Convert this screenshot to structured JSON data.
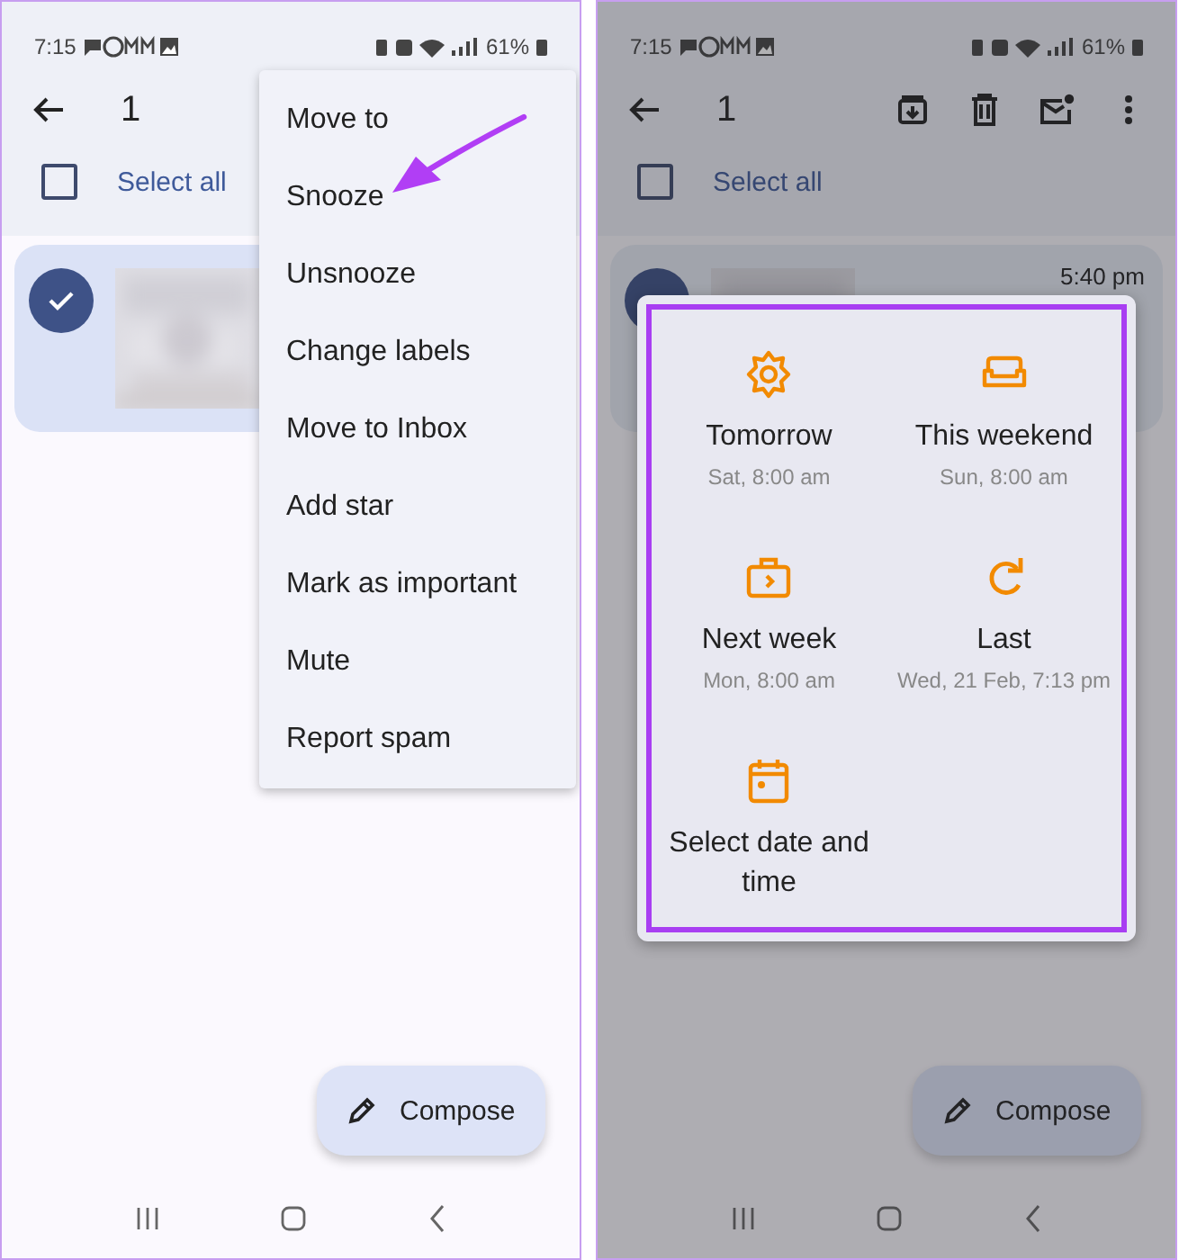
{
  "screens": [
    {
      "kind": "menu",
      "dimmed": false,
      "status_bar": {
        "time": "7:15",
        "battery": "61%"
      },
      "app_bar": {
        "count": "1"
      },
      "select_all": {
        "label": "Select all",
        "checked": false
      },
      "email": {
        "selected": true
      },
      "overflow_menu": {
        "items": [
          {
            "label": "Move to",
            "annotated": false
          },
          {
            "label": "Snooze",
            "annotated": true
          },
          {
            "label": "Unsnooze",
            "annotated": false
          },
          {
            "label": "Change labels",
            "annotated": false
          },
          {
            "label": "Move to Inbox",
            "annotated": false
          },
          {
            "label": "Add star",
            "annotated": false
          },
          {
            "label": "Mark as important",
            "annotated": false
          },
          {
            "label": "Mute",
            "annotated": false
          },
          {
            "label": "Report spam",
            "annotated": false
          }
        ]
      },
      "compose": {
        "label": "Compose"
      }
    },
    {
      "kind": "snooze_dialog",
      "dimmed": true,
      "status_bar": {
        "time": "7:15",
        "battery": "61%"
      },
      "app_bar": {
        "count": "1"
      },
      "select_all": {
        "label": "Select all",
        "checked": false
      },
      "email": {
        "selected": false,
        "time": "5:40 pm"
      },
      "snooze_dialog": {
        "highlighted": true,
        "options": [
          {
            "kind": "tomorrow",
            "label": "Tomorrow",
            "detail": "Sat, 8:00 am"
          },
          {
            "kind": "weekend",
            "label": "This weekend",
            "detail": "Sun, 8:00 am"
          },
          {
            "kind": "next_week",
            "label": "Next week",
            "detail": "Mon, 8:00 am"
          },
          {
            "kind": "last",
            "label": "Last",
            "detail": "Wed, 21 Feb, 7:13 pm"
          },
          {
            "kind": "custom",
            "label": "Select date and time"
          }
        ]
      },
      "compose": {
        "label": "Compose"
      }
    }
  ]
}
